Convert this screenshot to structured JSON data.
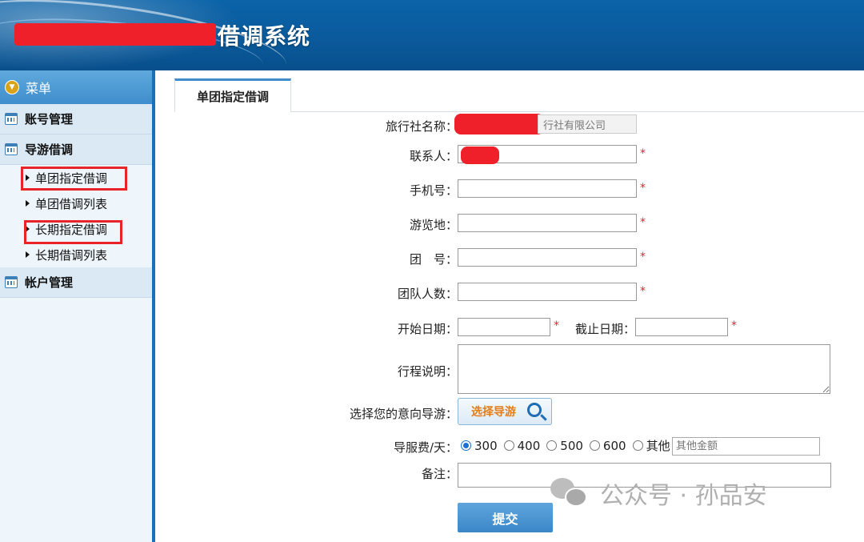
{
  "header": {
    "title": "借调系统"
  },
  "sidebar": {
    "menu_label": "菜单",
    "groups": [
      {
        "label": "账号管理"
      },
      {
        "label": "导游借调",
        "items": [
          "单团指定借调",
          "单团借调列表",
          "长期指定借调",
          "长期借调列表"
        ]
      },
      {
        "label": "帐户管理"
      }
    ]
  },
  "tabs": [
    {
      "label": "单团指定借调",
      "active": true
    }
  ],
  "form": {
    "agency_label": "旅行社名称：",
    "agency_value": "行社有限公司",
    "contact_label": "联系人：",
    "phone_label": "手机号：",
    "place_label": "游览地：",
    "group_no_label": "团　号：",
    "count_label": "团队人数：",
    "start_label": "开始日期：",
    "end_label": "截止日期：",
    "itinerary_label": "行程说明：",
    "guide_label": "选择您的意向导游：",
    "guide_button": "选择导游",
    "fee_label": "导服费/天：",
    "fee_options": [
      "300",
      "400",
      "500",
      "600",
      "其他"
    ],
    "fee_selected": "300",
    "other_placeholder": "其他金额",
    "remark_label": "备注：",
    "submit_label": "提交",
    "required_mark": "*"
  },
  "watermark": {
    "text": "公众号 · 孙品安"
  },
  "colors": {
    "header_bg": "#0a5a9c",
    "accent": "#3f8dcc",
    "required": "#e0262c",
    "highlight": "#e8232a"
  }
}
